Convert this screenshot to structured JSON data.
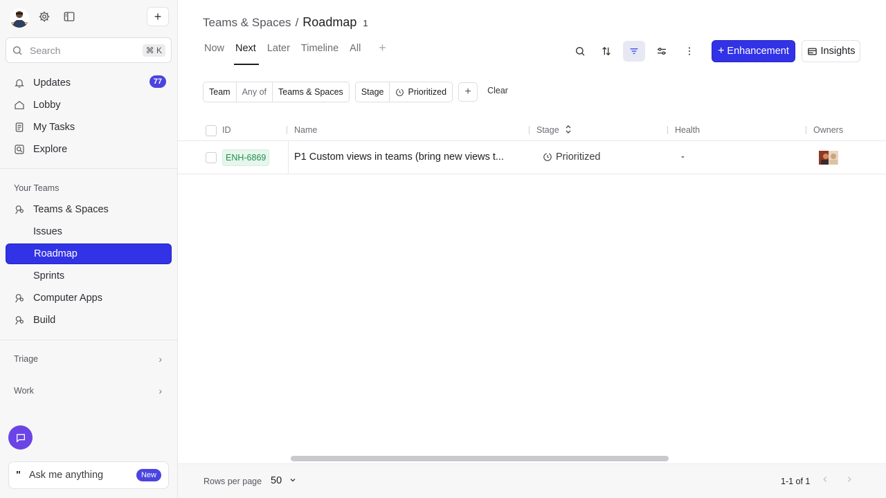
{
  "sidebar": {
    "search": {
      "placeholder": "Search",
      "shortcut": "⌘ K"
    },
    "nav": [
      {
        "label": "Updates",
        "badge": "77"
      },
      {
        "label": "Lobby"
      },
      {
        "label": "My Tasks"
      },
      {
        "label": "Explore"
      }
    ],
    "your_teams_label": "Your Teams",
    "teams": [
      {
        "label": "Teams & Spaces"
      },
      {
        "label": "Issues"
      },
      {
        "label": "Roadmap"
      },
      {
        "label": "Sprints"
      },
      {
        "label": "Computer Apps"
      },
      {
        "label": "Build"
      }
    ],
    "sections": [
      {
        "label": "Triage"
      },
      {
        "label": "Work"
      }
    ],
    "ask": {
      "label": "Ask me anything",
      "badge": "New"
    }
  },
  "header": {
    "breadcrumb_parent": "Teams & Spaces",
    "breadcrumb_sep": "/",
    "title": "Roadmap",
    "count": "1"
  },
  "tabs": [
    "Now",
    "Next",
    "Later",
    "Timeline",
    "All"
  ],
  "active_tab": "Next",
  "actions": {
    "enhancement": "Enhancement",
    "insights": "Insights"
  },
  "filters": {
    "team": {
      "field": "Team",
      "operator": "Any of",
      "value": "Teams & Spaces"
    },
    "stage": {
      "field": "Stage",
      "value": "Prioritized"
    },
    "clear": "Clear"
  },
  "table": {
    "columns": [
      "ID",
      "Name",
      "Stage",
      "Health",
      "Owners"
    ],
    "rows": [
      {
        "id": "ENH-6869",
        "name": "P1 Custom views in teams (bring new views t...",
        "stage": "Prioritized",
        "health": "-"
      }
    ]
  },
  "footer": {
    "rows_per_page_label": "Rows per page",
    "rows_per_page": "50",
    "range": "1-1 of 1"
  },
  "colors": {
    "accent": "#3232e6",
    "badge": "#4a44e0",
    "id_pill_text": "#1f8f4e",
    "chat_fab": "#6b44e6"
  }
}
